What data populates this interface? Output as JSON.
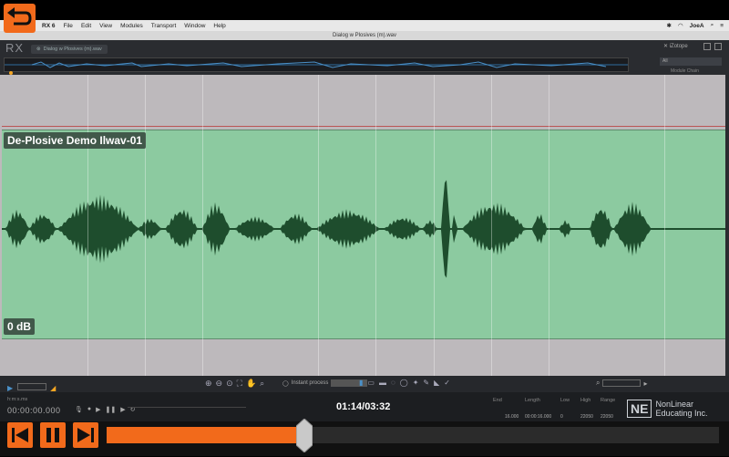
{
  "menubar": {
    "app_name": "RX 6",
    "items": [
      "File",
      "Edit",
      "View",
      "Modules",
      "Transport",
      "Window",
      "Help"
    ],
    "user": "JoeA"
  },
  "window": {
    "title": "Dialog w Plosives (m).wav",
    "file_tab": "Dialog w Plosives (m).wav",
    "logo": "RX",
    "brand": "iZotope",
    "module_select": "All",
    "module_chain": "Module Chain"
  },
  "clip": {
    "name": "De-Plosive Demo Ilwav-01",
    "gain": "0 dB"
  },
  "toolbar": {
    "instant_process": "Instant process"
  },
  "status": {
    "time_format": "h:m:s.ms",
    "time_value": "00:00:00.000",
    "columns": [
      "End",
      "Length",
      "Low",
      "High",
      "Range"
    ],
    "values": [
      "16.000",
      "00:00:16.000",
      "0",
      "22050",
      "22050"
    ]
  },
  "player": {
    "time_display": "01:14/03:32",
    "progress": 0.35,
    "accent": "#f26a1b"
  },
  "logo": {
    "mark": "NE",
    "line1": "NonLinear",
    "line2": "Educating Inc."
  },
  "icons": [
    "back-icon",
    "skip-back-icon",
    "pause-icon",
    "skip-forward-icon",
    "search-icon",
    "zoom-icon"
  ]
}
